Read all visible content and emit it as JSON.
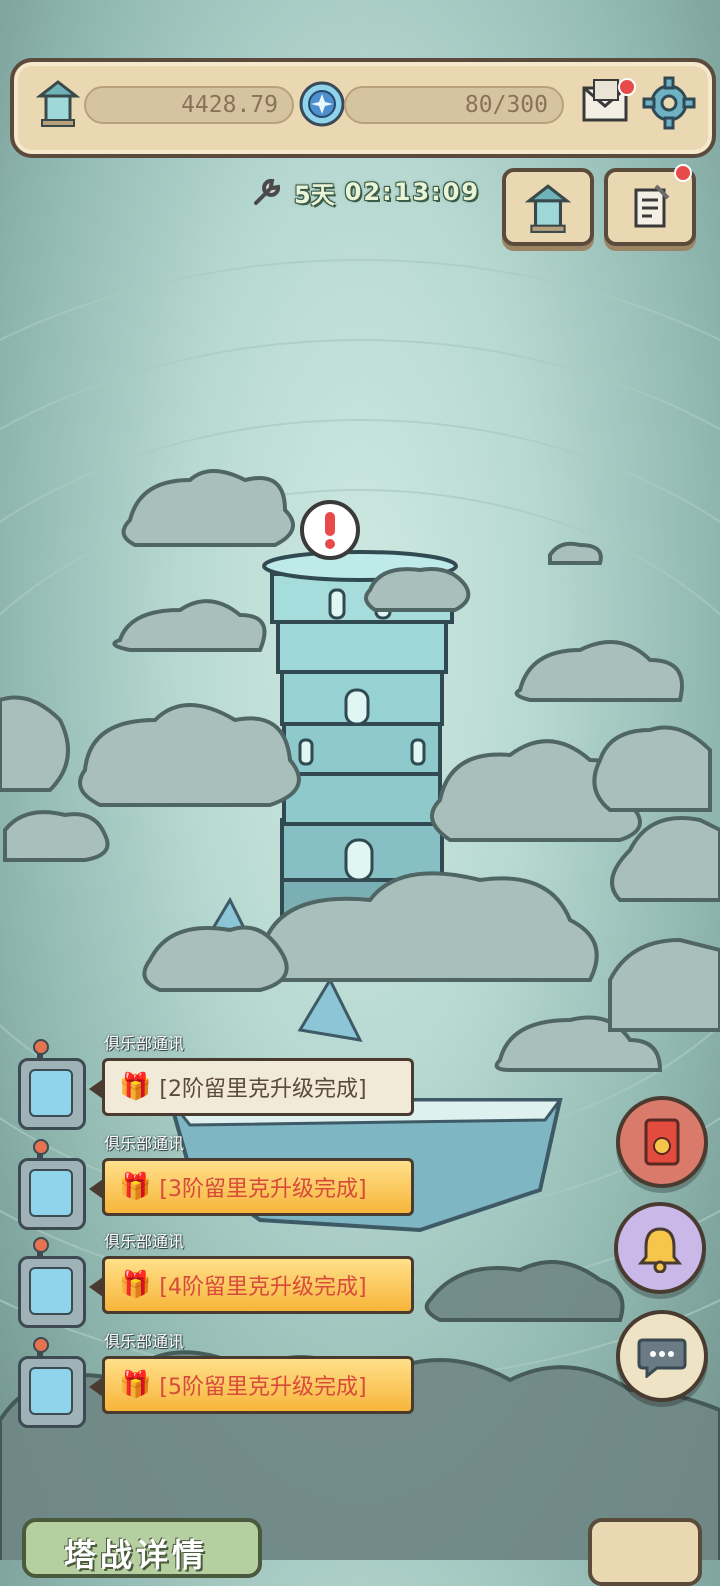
{
  "resources": {
    "tower_points": "4428.79",
    "energy": "80/300"
  },
  "timer": {
    "days": "5天",
    "clock": "02:13:09"
  },
  "notifications": [
    {
      "sender": "俱乐部通讯",
      "message": "[2阶留里克升级完成]",
      "style": "plain"
    },
    {
      "sender": "俱乐部通讯",
      "message": "[3阶留里克升级完成]",
      "style": "gold"
    },
    {
      "sender": "俱乐部通讯",
      "message": "[4阶留里克升级完成]",
      "style": "gold"
    },
    {
      "sender": "俱乐部通讯",
      "message": "[5阶留里克升级完成]",
      "style": "gold"
    }
  ],
  "bottom": {
    "left_tab": "塔战详情"
  },
  "icons": {
    "tower": "tower-icon",
    "energy_orb": "energy-orb-icon",
    "mail": "mail-icon",
    "settings": "gear-icon",
    "wrench": "wrench-icon",
    "scroll": "scroll-icon",
    "gift": "gift-icon",
    "red_packet": "red-packet-icon",
    "bell": "bell-icon",
    "chat": "chat-icon"
  },
  "colors": {
    "panel": "#e9d8b1",
    "outline": "#5a4b3c",
    "alert": "#e74b49",
    "gold": "#f7b53a",
    "message_red": "#d84a3b"
  }
}
